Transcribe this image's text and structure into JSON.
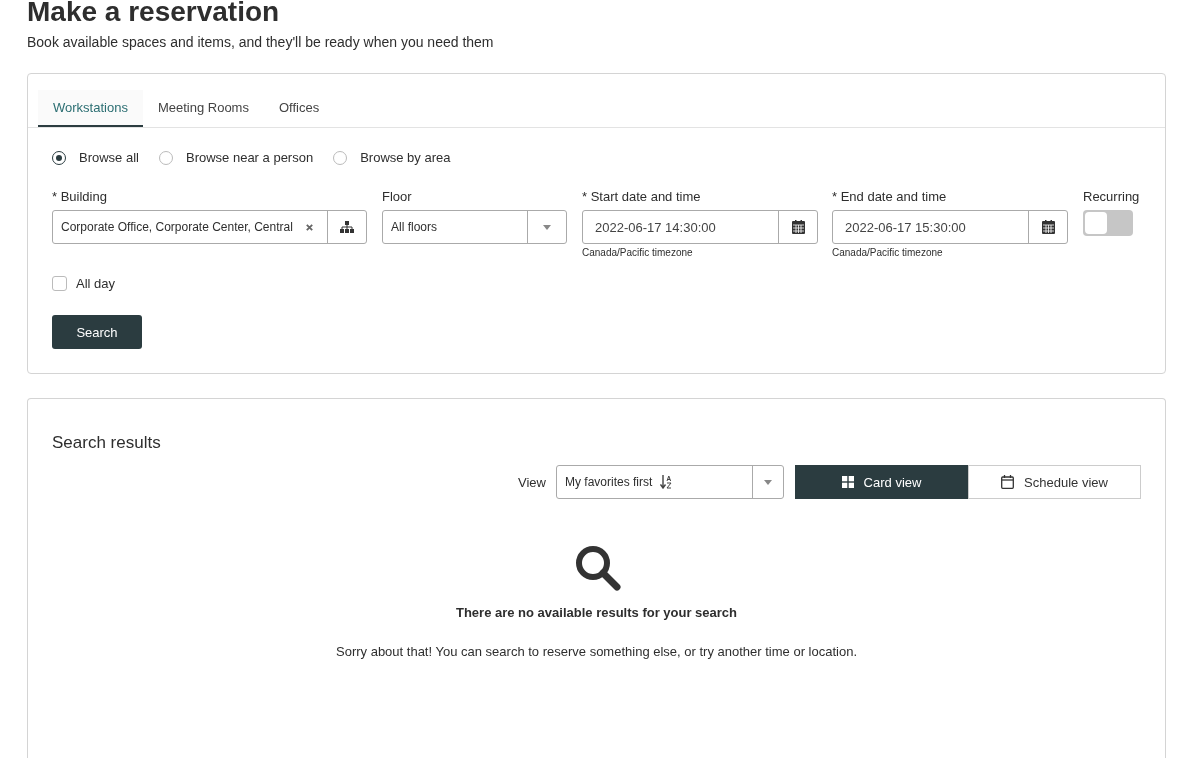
{
  "page": {
    "title": "Make a reservation",
    "subtitle": "Book available spaces and items, and they'll be ready when you need them"
  },
  "tabs": [
    {
      "label": "Workstations",
      "selected": true
    },
    {
      "label": "Meeting Rooms",
      "selected": false
    },
    {
      "label": "Offices",
      "selected": false
    }
  ],
  "browse_options": [
    {
      "label": "Browse all",
      "selected": true
    },
    {
      "label": "Browse near a person",
      "selected": false
    },
    {
      "label": "Browse by area",
      "selected": false
    }
  ],
  "building": {
    "label": "* Building",
    "value": "Corporate Office, Corporate Center, Central"
  },
  "floor": {
    "label": "Floor",
    "value": "All floors"
  },
  "start": {
    "label": "* Start date and time",
    "value": "2022-06-17 14:30:00",
    "timezone": "Canada/Pacific timezone"
  },
  "end": {
    "label": "* End date and time",
    "value": "2022-06-17 15:30:00",
    "timezone": "Canada/Pacific timezone"
  },
  "recurring": {
    "label": "Recurring",
    "on": false
  },
  "all_day": {
    "label": "All day",
    "checked": false
  },
  "search_button": "Search",
  "results": {
    "title": "Search results",
    "view_label": "View",
    "sort": "My favorites first",
    "views": [
      {
        "kind": "card",
        "label": "Card view",
        "selected": true
      },
      {
        "kind": "schedule",
        "label": "Schedule view",
        "selected": false
      }
    ],
    "empty_title": "There are no available results for your search",
    "empty_message": "Sorry about that! You can search to reserve something else, or try another time or location."
  }
}
